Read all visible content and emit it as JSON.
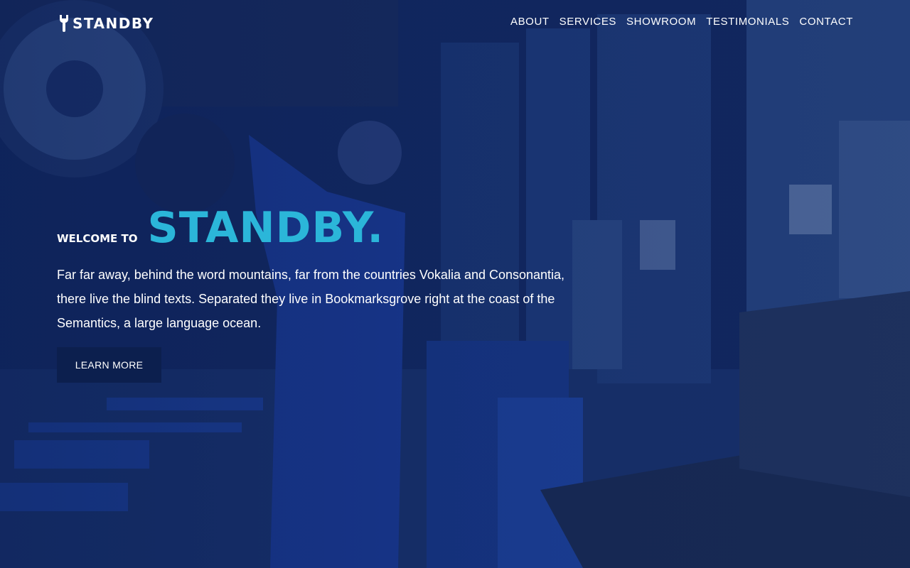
{
  "brand": {
    "name": "STANDBY",
    "icon": "wrench-icon"
  },
  "nav": {
    "items": [
      {
        "label": "ABOUT"
      },
      {
        "label": "SERVICES"
      },
      {
        "label": "SHOWROOM"
      },
      {
        "label": "TESTIMONIALS"
      },
      {
        "label": "CONTACT"
      }
    ]
  },
  "hero": {
    "welcome": "WELCOME TO",
    "title": "STANDBY.",
    "description": "Far far away, behind the word mountains, far from the countries Vokalia and Consonantia, there live the blind texts. Separated they live in Bookmarksgrove right at the coast of the Semantics, a large language ocean.",
    "button_label": "LEARN MORE"
  },
  "colors": {
    "overlay": "#0f2256",
    "accent": "#2bb6d9",
    "button": "#0c1f4e",
    "text": "#ffffff"
  }
}
